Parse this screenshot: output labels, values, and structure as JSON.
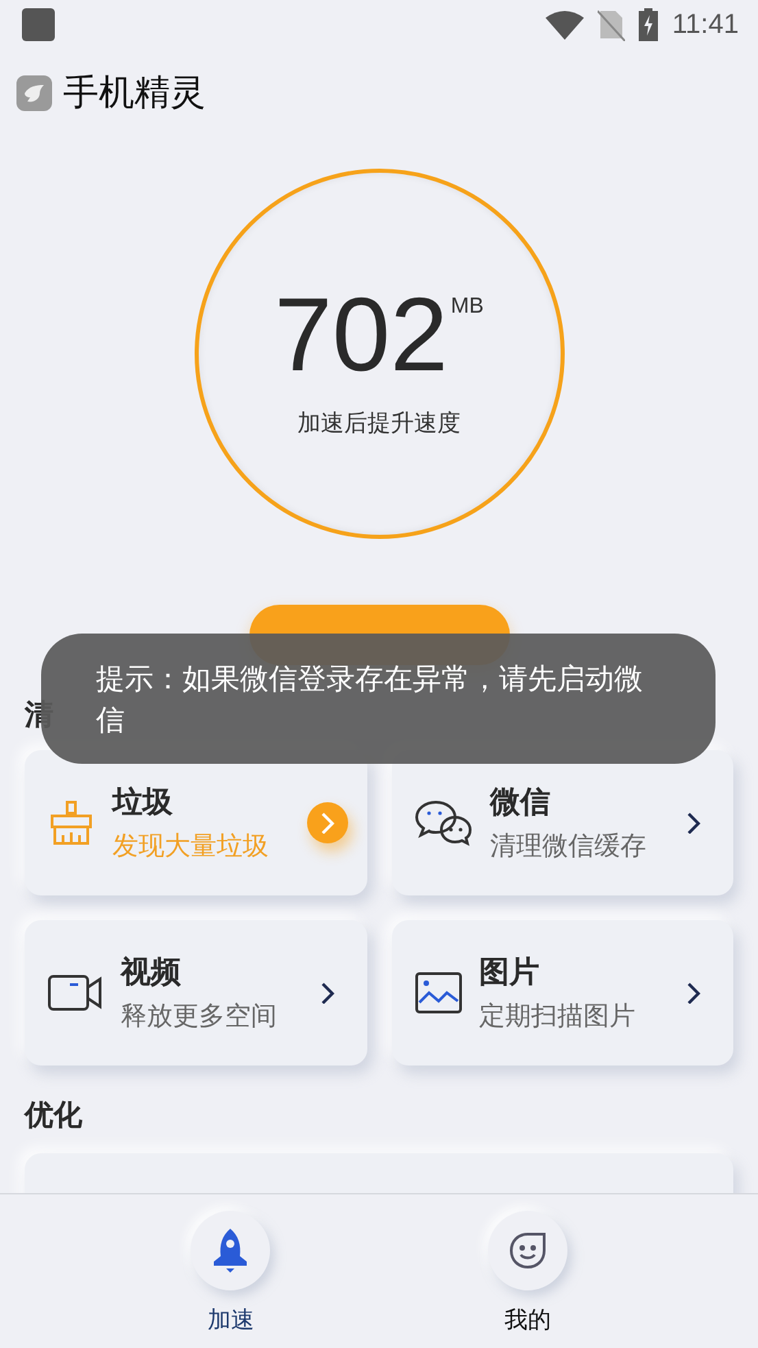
{
  "status_bar": {
    "time": "11:41"
  },
  "app": {
    "title": "手机精灵"
  },
  "gauge": {
    "value": "702",
    "unit": "MB",
    "caption": "加速后提升速度"
  },
  "boost_button": {
    "kind": "pill"
  },
  "toast": {
    "text": "提示：如果微信登录存在异常，请先启动微信"
  },
  "sections": [
    {
      "title": "清",
      "cards": [
        {
          "kind": "trash",
          "title": "垃圾",
          "subtitle": "发现大量垃圾",
          "highlighted": true
        },
        {
          "kind": "wechat",
          "title": "微信",
          "subtitle": "清理微信缓存",
          "highlighted": false
        },
        {
          "kind": "video",
          "title": "视频",
          "subtitle": "释放更多空间",
          "highlighted": false
        },
        {
          "kind": "image",
          "title": "图片",
          "subtitle": "定期扫描图片",
          "highlighted": false
        }
      ]
    },
    {
      "title": "优化",
      "cards": [
        {
          "kind": "wide"
        }
      ]
    }
  ],
  "nav": [
    {
      "kind": "rocket",
      "label": "加速",
      "selected": true
    },
    {
      "kind": "face",
      "label": "我的",
      "selected": false
    }
  ]
}
